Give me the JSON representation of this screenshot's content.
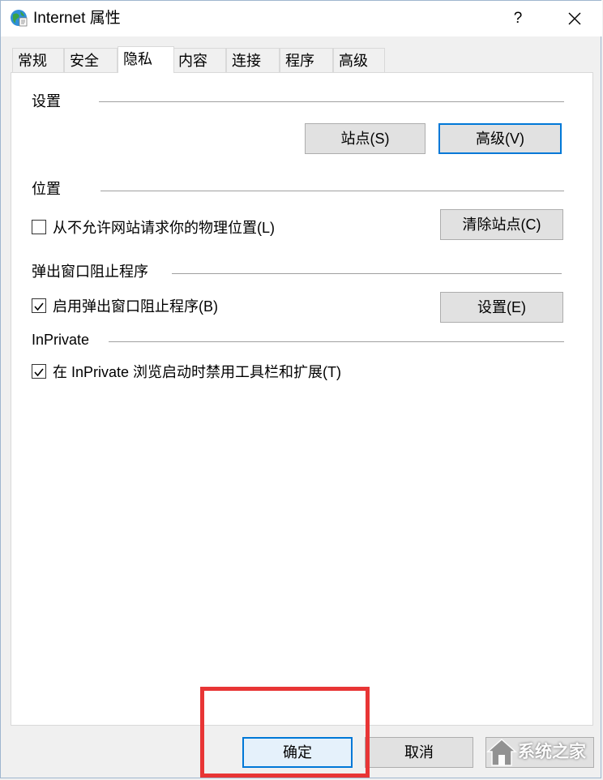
{
  "window": {
    "title": "Internet 属性",
    "help_label": "?"
  },
  "tabs": [
    {
      "label": "常规",
      "active": false
    },
    {
      "label": "安全",
      "active": false
    },
    {
      "label": "隐私",
      "active": true
    },
    {
      "label": "内容",
      "active": false
    },
    {
      "label": "连接",
      "active": false
    },
    {
      "label": "程序",
      "active": false
    },
    {
      "label": "高级",
      "active": false
    }
  ],
  "settings": {
    "title": "设置",
    "sites_button": "站点(S)",
    "advanced_button": "高级(V)"
  },
  "location": {
    "title": "位置",
    "never_allow_label": "从不允许网站请求你的物理位置(L)",
    "never_allow_checked": false,
    "clear_sites_button": "清除站点(C)"
  },
  "popup": {
    "title": "弹出窗口阻止程序",
    "enable_label": "启用弹出窗口阻止程序(B)",
    "enable_checked": true,
    "settings_button": "设置(E)"
  },
  "inprivate": {
    "title": "InPrivate",
    "disable_toolbars_label": "在 InPrivate 浏览启动时禁用工具栏和扩展(T)",
    "disable_toolbars_checked": true
  },
  "footer": {
    "ok_button": "确定",
    "cancel_button": "取消"
  },
  "watermark": {
    "text": "系统之家"
  },
  "colors": {
    "accent": "#0078d7",
    "highlight": "#e83535"
  }
}
